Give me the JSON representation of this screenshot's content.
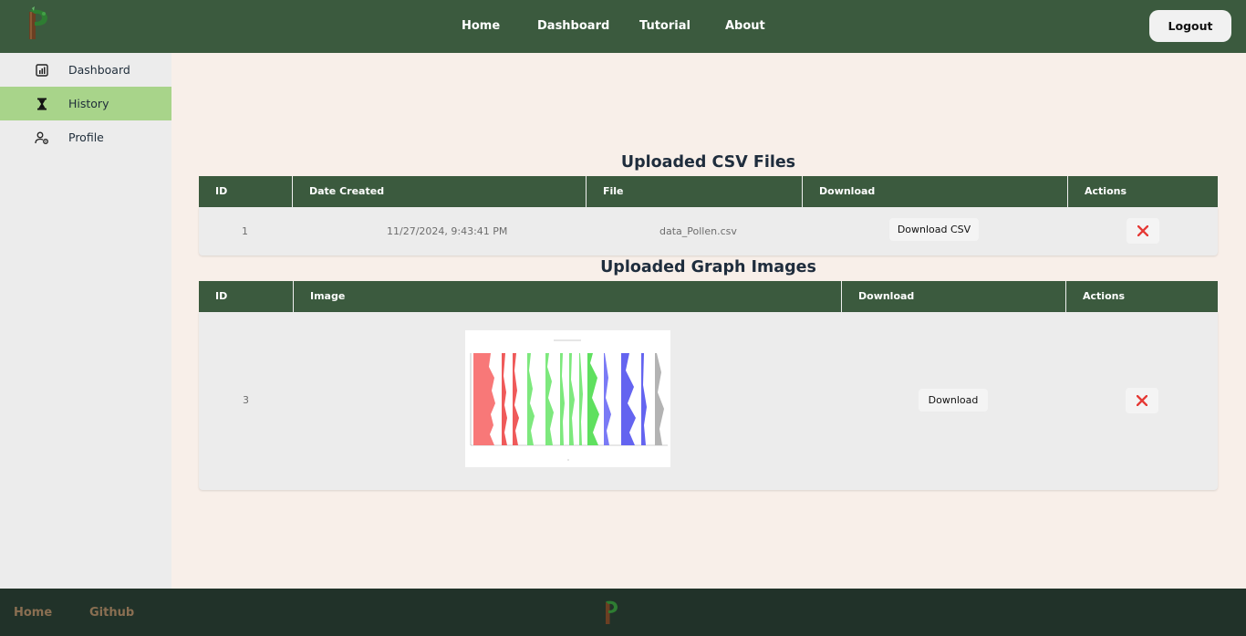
{
  "nav": {
    "links": [
      "Home",
      "Dashboard",
      "Tutorial",
      "About"
    ],
    "logout": "Logout"
  },
  "sidebar": {
    "items": [
      {
        "label": "Dashboard",
        "icon": "chart-icon",
        "active": false
      },
      {
        "label": "History",
        "icon": "hourglass-icon",
        "active": true
      },
      {
        "label": "Profile",
        "icon": "user-gear-icon",
        "active": false
      }
    ]
  },
  "csv": {
    "title": "Uploaded CSV Files",
    "headers": [
      "ID",
      "Date Created",
      "File",
      "Download",
      "Actions"
    ],
    "rows": [
      {
        "id": "1",
        "date": "11/27/2024, 9:43:41 PM",
        "file": "data_Pollen.csv",
        "download": "Download CSV"
      }
    ]
  },
  "images": {
    "title": "Uploaded Graph Images",
    "headers": [
      "ID",
      "Image",
      "Download",
      "Actions"
    ],
    "rows": [
      {
        "id": "3",
        "download": "Download"
      }
    ]
  },
  "footer": {
    "links": [
      "Home",
      "Github"
    ]
  },
  "colors": {
    "header": "#3b5a3e",
    "active": "#a8d48a",
    "delete": "#e53935",
    "footer": "#213229"
  }
}
